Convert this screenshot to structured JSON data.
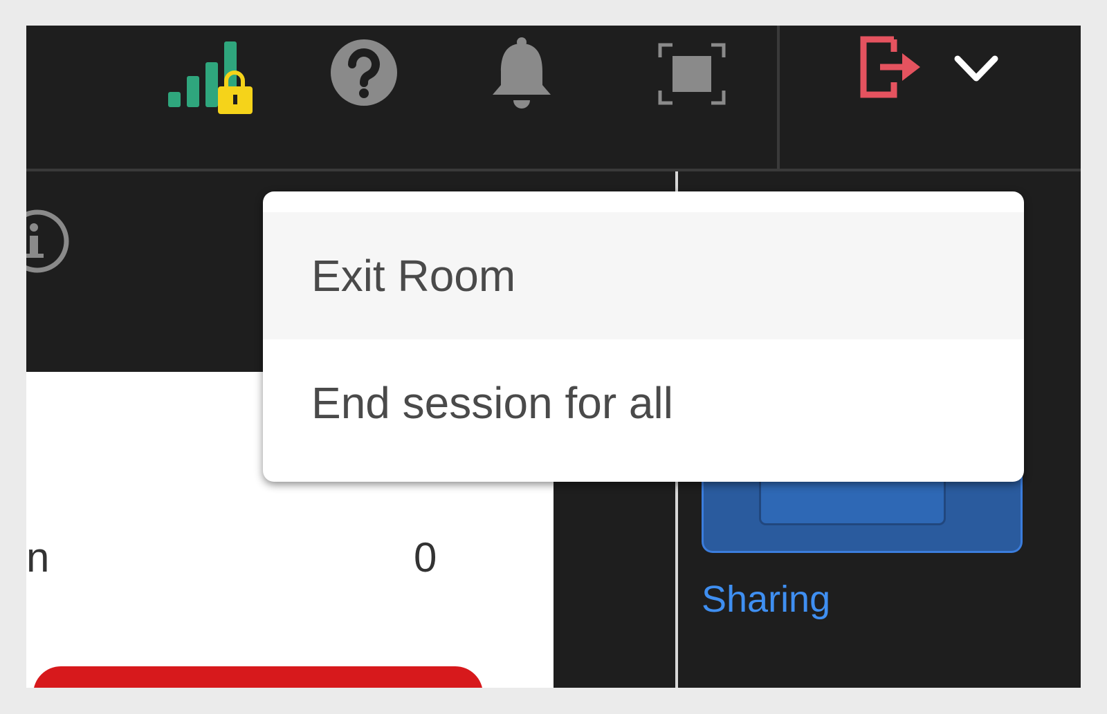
{
  "colors": {
    "topbar_bg": "#1e1e1e",
    "signal_green": "#2fa67d",
    "lock_yellow": "#f5d31a",
    "icon_gray": "#8a8a8a",
    "exit_red": "#e5535f",
    "link_blue": "#3f8ff1",
    "menu_text": "#4a4a4a"
  },
  "toolbar": {
    "icons": [
      "signal-lock-icon",
      "help-icon",
      "bell-icon",
      "fullscreen-icon",
      "exit-room-icon",
      "chevron-down-icon"
    ]
  },
  "main": {
    "row_label_fragment": "n",
    "row_value": "0"
  },
  "right_panel": {
    "sharing_label": "Sharing"
  },
  "exit_menu": {
    "items": [
      {
        "label": "Exit Room"
      },
      {
        "label": "End session for all"
      }
    ]
  }
}
